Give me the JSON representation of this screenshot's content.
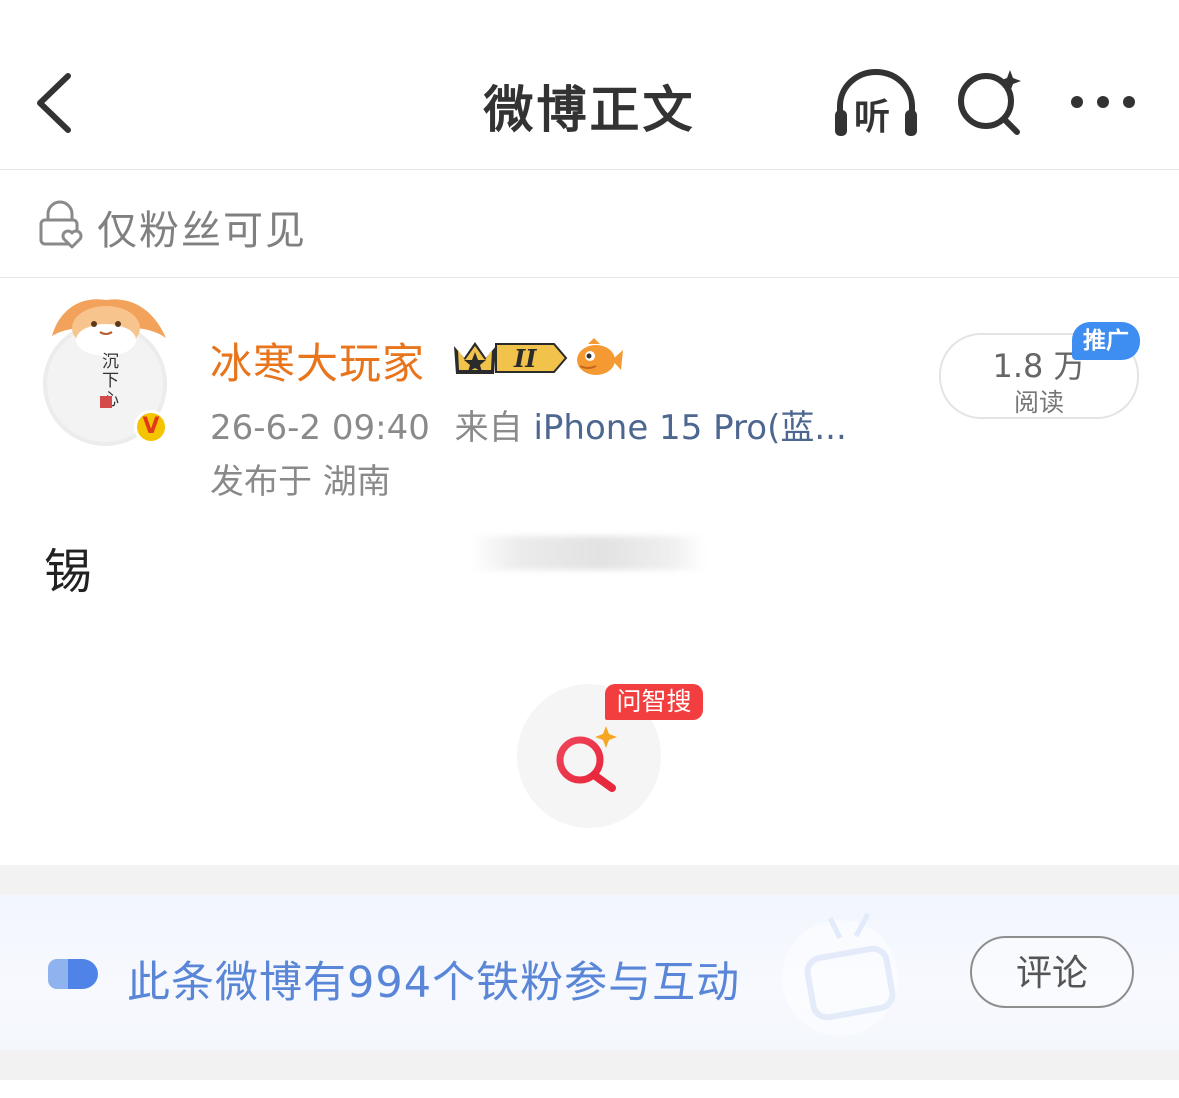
{
  "nav": {
    "title": "微博正文",
    "back_icon": "chevron-left-icon",
    "listen_label": "听",
    "ai_search_icon": "ai-search-icon",
    "more_icon": "more-dots-icon"
  },
  "visibility": {
    "icon": "lock-heart-icon",
    "label": "仅粉丝可见"
  },
  "post": {
    "author": {
      "name": "冰寒大玩家",
      "avatar_text": "沉下心",
      "verified_badge": "V",
      "level_badge": "II"
    },
    "timestamp": "26-6-2 09:40",
    "source_prefix": "来自",
    "source": "iPhone 15 Pro(蓝...",
    "location": "发布于 湖南",
    "reads": {
      "count": "1.8 万",
      "label": "阅读",
      "promo_badge": "推广"
    },
    "content": "锡",
    "ask_badge": "问智搜"
  },
  "fan_interaction": {
    "text": "此条微博有994个铁粉参与互动",
    "comment_button": "评论"
  },
  "colors": {
    "author_name": "#e8741c",
    "source_link": "#4e6790",
    "fan_text": "#5a86d8",
    "promo": "#3d8ef0",
    "ask_badge": "#f23e3e",
    "verified": "#f5c400"
  }
}
